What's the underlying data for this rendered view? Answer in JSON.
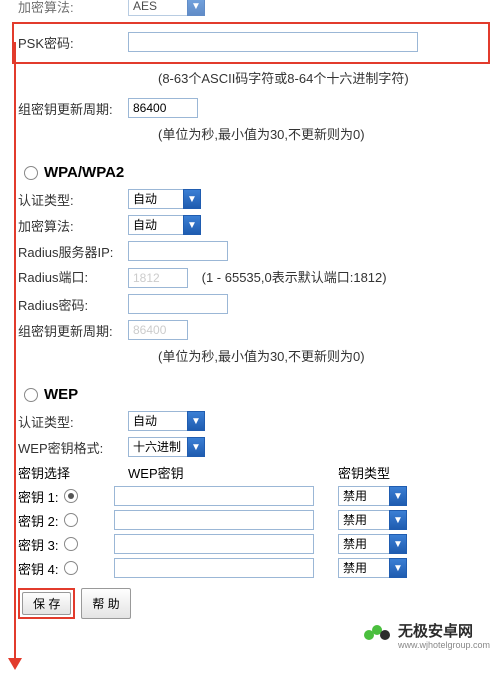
{
  "top": {
    "encrypt_algo_label": "加密算法:",
    "encrypt_algo_value": "AES",
    "psk_label": "PSK密码:",
    "psk_value": "",
    "psk_hint": "(8-63个ASCII码字符或8-64个十六进制字符)",
    "group_key_label": "组密钥更新周期:",
    "group_key_value": "86400",
    "group_key_hint": "(单位为秒,最小值为30,不更新则为0)"
  },
  "wpa": {
    "title": "WPA/WPA2",
    "auth_label": "认证类型:",
    "auth_value": "自动",
    "algo_label": "加密算法:",
    "algo_value": "自动",
    "radius_ip_label": "Radius服务器IP:",
    "radius_ip_value": "",
    "radius_port_label": "Radius端口:",
    "radius_port_value": "1812",
    "radius_port_hint": "(1 - 65535,0表示默认端口:1812)",
    "radius_pwd_label": "Radius密码:",
    "radius_pwd_value": "",
    "group_key_label": "组密钥更新周期:",
    "group_key_value": "86400",
    "group_key_hint": "(单位为秒,最小值为30,不更新则为0)"
  },
  "wep": {
    "title": "WEP",
    "auth_label": "认证类型:",
    "auth_value": "自动",
    "fmt_label": "WEP密钥格式:",
    "fmt_value": "十六进制",
    "col_select": "密钥选择",
    "col_key": "WEP密钥",
    "col_type": "密钥类型",
    "rows": [
      {
        "label": "密钥 1:",
        "selected": true,
        "type": "禁用"
      },
      {
        "label": "密钥 2:",
        "selected": false,
        "type": "禁用"
      },
      {
        "label": "密钥 3:",
        "selected": false,
        "type": "禁用"
      },
      {
        "label": "密钥 4:",
        "selected": false,
        "type": "禁用"
      }
    ]
  },
  "buttons": {
    "save": "保 存",
    "help": "帮 助"
  },
  "watermark": {
    "name": "无极安卓网",
    "sub": "www.wjhotelgroup.com"
  }
}
